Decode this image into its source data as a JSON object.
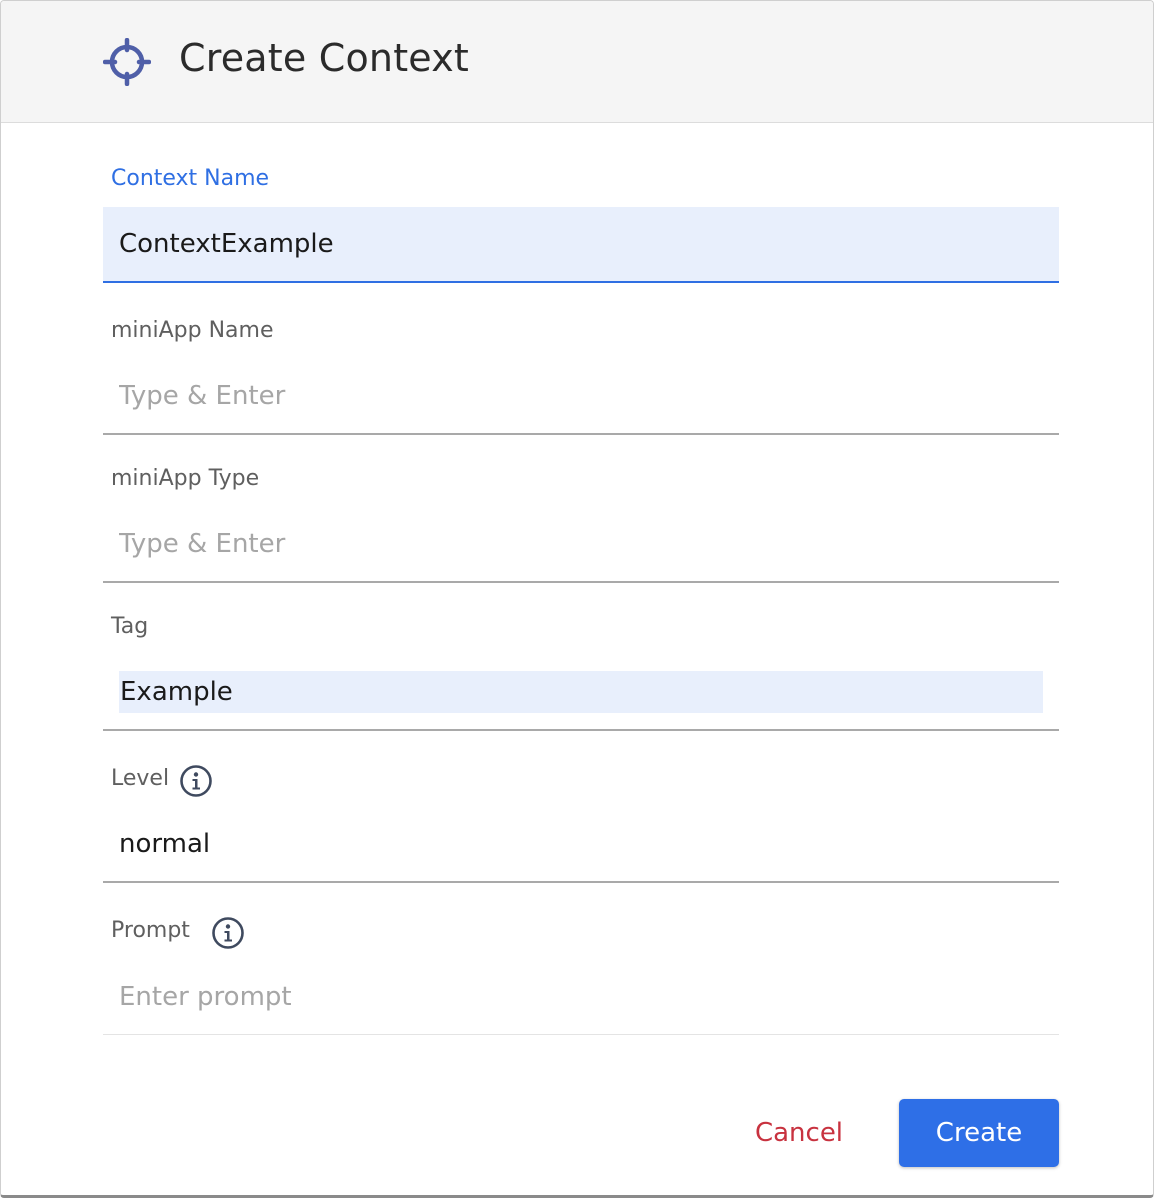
{
  "dialog": {
    "title": "Create Context",
    "title_icon": "crosshair-icon"
  },
  "fields": {
    "context_name": {
      "label": "Context Name",
      "value": "ContextExample",
      "placeholder": ""
    },
    "miniapp_name": {
      "label": "miniApp Name",
      "value": "",
      "placeholder": "Type & Enter"
    },
    "miniapp_type": {
      "label": "miniApp Type",
      "value": "",
      "placeholder": "Type & Enter"
    },
    "tag": {
      "label": "Tag",
      "chip": "Example"
    },
    "level": {
      "label": "Level",
      "value": "normal",
      "info_icon": "info-icon"
    },
    "prompt": {
      "label": "Prompt",
      "value": "",
      "placeholder": "Enter prompt",
      "info_icon": "info-icon"
    }
  },
  "actions": {
    "cancel_label": "Cancel",
    "create_label": "Create"
  },
  "colors": {
    "accent": "#2e6fe7",
    "focus_fill": "#e8effc",
    "cancel": "#c8323f",
    "icon": "#4f5fa8"
  }
}
